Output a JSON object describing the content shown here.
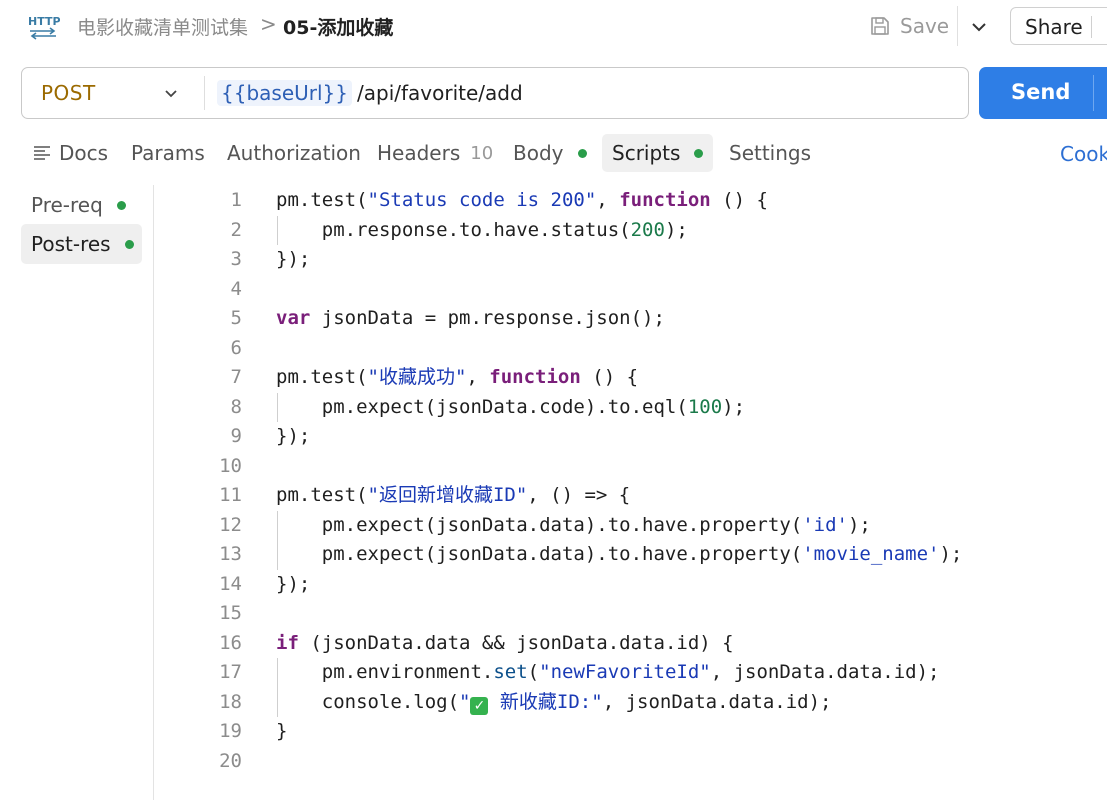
{
  "header": {
    "icon_name": "http-icon",
    "breadcrumb_parent": "电影收藏清单测试集",
    "breadcrumb_separator": ">",
    "breadcrumb_current": "05-添加收藏",
    "save_label": "Save",
    "share_label": "Share"
  },
  "request": {
    "method": "POST",
    "url_variable": "{{baseUrl}}",
    "url_path": " /api/favorite/add",
    "send_label": "Send"
  },
  "tabs": [
    {
      "label": "Docs"
    },
    {
      "label": "Params"
    },
    {
      "label": "Authorization"
    },
    {
      "label": "Headers",
      "count": "10"
    },
    {
      "label": "Body"
    },
    {
      "label": "Scripts"
    },
    {
      "label": "Settings"
    }
  ],
  "cookies_label": "Cook",
  "script_nav": [
    {
      "label": "Pre-req"
    },
    {
      "label": "Post-res"
    }
  ],
  "colors": {
    "accent": "#2e7ee6",
    "method": "#9b6a00",
    "status_dot": "#2a9d4a"
  },
  "code_lines": [
    [
      {
        "t": "pm.test("
      },
      {
        "t": "\"Status code is 200\"",
        "c": "str"
      },
      {
        "t": ", "
      },
      {
        "t": "function",
        "c": "kw"
      },
      {
        "t": " () {"
      }
    ],
    [
      {
        "t": "    pm.response.to.have.status("
      },
      {
        "t": "200",
        "c": "num"
      },
      {
        "t": ");"
      }
    ],
    [
      {
        "t": "});"
      }
    ],
    [],
    [
      {
        "t": "var",
        "c": "kw"
      },
      {
        "t": " jsonData = pm.response.json();"
      }
    ],
    [],
    [
      {
        "t": "pm.test("
      },
      {
        "t": "\"收藏成功\"",
        "c": "str"
      },
      {
        "t": ", "
      },
      {
        "t": "function",
        "c": "kw"
      },
      {
        "t": " () {"
      }
    ],
    [
      {
        "t": "    pm.expect(jsonData.code).to.eql("
      },
      {
        "t": "100",
        "c": "num"
      },
      {
        "t": ");"
      }
    ],
    [
      {
        "t": "});"
      }
    ],
    [],
    [
      {
        "t": "pm.test("
      },
      {
        "t": "\"返回新增收藏ID\"",
        "c": "str"
      },
      {
        "t": ", () => {"
      }
    ],
    [
      {
        "t": "    pm.expect(jsonData.data).to.have.property("
      },
      {
        "t": "'id'",
        "c": "str"
      },
      {
        "t": ");"
      }
    ],
    [
      {
        "t": "    pm.expect(jsonData.data).to.have.property("
      },
      {
        "t": "'movie_name'",
        "c": "str"
      },
      {
        "t": ");"
      }
    ],
    [
      {
        "t": "});"
      }
    ],
    [],
    [
      {
        "t": "if",
        "c": "kw"
      },
      {
        "t": " (jsonData.data && jsonData.data.id) {"
      }
    ],
    [
      {
        "t": "    pm.environment."
      },
      {
        "t": "set",
        "c": "fn"
      },
      {
        "t": "("
      },
      {
        "t": "\"newFavoriteId\"",
        "c": "str"
      },
      {
        "t": ", jsonData.data.id);"
      }
    ],
    [
      {
        "t": "    console.log("
      },
      {
        "t": "\"",
        "c": "str"
      },
      {
        "t": "✓",
        "c": "chk"
      },
      {
        "t": " 新收藏ID:\"",
        "c": "str"
      },
      {
        "t": ", jsonData.data.id);"
      }
    ],
    [
      {
        "t": "}"
      }
    ],
    []
  ]
}
